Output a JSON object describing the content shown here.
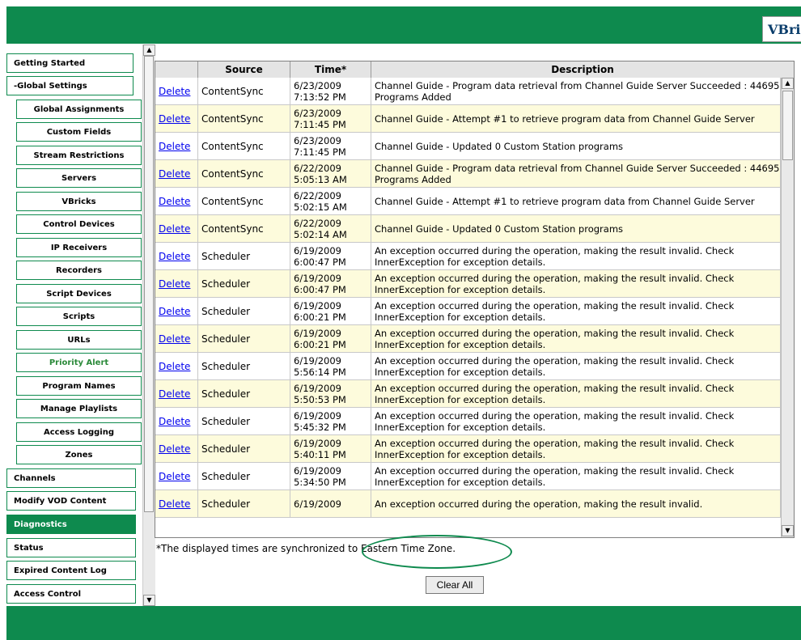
{
  "brand": {
    "logo_text": "VBrick"
  },
  "sidebar": {
    "items": [
      {
        "label": "Getting Started"
      },
      {
        "label": "-Global Settings"
      },
      {
        "label": "Global Assignments"
      },
      {
        "label": "Custom Fields"
      },
      {
        "label": "Stream Restrictions"
      },
      {
        "label": "Servers"
      },
      {
        "label": "VBricks"
      },
      {
        "label": "Control Devices"
      },
      {
        "label": "IP Receivers"
      },
      {
        "label": "Recorders"
      },
      {
        "label": "Script Devices"
      },
      {
        "label": "Scripts"
      },
      {
        "label": "URLs"
      },
      {
        "label": "Priority Alert"
      },
      {
        "label": "Program Names"
      },
      {
        "label": "Manage Playlists"
      },
      {
        "label": "Access Logging"
      },
      {
        "label": "Zones"
      },
      {
        "label": "Channels"
      },
      {
        "label": "Modify VOD Content"
      },
      {
        "label": "Diagnostics"
      },
      {
        "label": "Status"
      },
      {
        "label": "Expired Content Log"
      },
      {
        "label": "Access Control"
      }
    ]
  },
  "table": {
    "columns": [
      "",
      "Source",
      "Time*",
      "Description"
    ],
    "delete_label": "Delete",
    "rows": [
      {
        "source": "ContentSync",
        "date": "6/23/2009",
        "time": "7:13:52 PM",
        "description": "Channel Guide - Program data retrieval from Channel Guide Server Succeeded : 44695 Programs Added"
      },
      {
        "source": "ContentSync",
        "date": "6/23/2009",
        "time": "7:11:45 PM",
        "description": "Channel Guide - Attempt #1 to retrieve program data from Channel Guide Server"
      },
      {
        "source": "ContentSync",
        "date": "6/23/2009",
        "time": "7:11:45 PM",
        "description": "Channel Guide - Updated 0 Custom Station programs"
      },
      {
        "source": "ContentSync",
        "date": "6/22/2009",
        "time": "5:05:13 AM",
        "description": "Channel Guide - Program data retrieval from Channel Guide Server Succeeded : 44695 Programs Added"
      },
      {
        "source": "ContentSync",
        "date": "6/22/2009",
        "time": "5:02:15 AM",
        "description": "Channel Guide - Attempt #1 to retrieve program data from Channel Guide Server"
      },
      {
        "source": "ContentSync",
        "date": "6/22/2009",
        "time": "5:02:14 AM",
        "description": "Channel Guide - Updated 0 Custom Station programs"
      },
      {
        "source": "Scheduler",
        "date": "6/19/2009",
        "time": "6:00:47 PM",
        "description": "An exception occurred during the operation, making the result invalid. Check InnerException for exception details."
      },
      {
        "source": "Scheduler",
        "date": "6/19/2009",
        "time": "6:00:47 PM",
        "description": "An exception occurred during the operation, making the result invalid. Check InnerException for exception details."
      },
      {
        "source": "Scheduler",
        "date": "6/19/2009",
        "time": "6:00:21 PM",
        "description": "An exception occurred during the operation, making the result invalid. Check InnerException for exception details."
      },
      {
        "source": "Scheduler",
        "date": "6/19/2009",
        "time": "6:00:21 PM",
        "description": "An exception occurred during the operation, making the result invalid. Check InnerException for exception details."
      },
      {
        "source": "Scheduler",
        "date": "6/19/2009",
        "time": "5:56:14 PM",
        "description": "An exception occurred during the operation, making the result invalid. Check InnerException for exception details."
      },
      {
        "source": "Scheduler",
        "date": "6/19/2009",
        "time": "5:50:53 PM",
        "description": "An exception occurred during the operation, making the result invalid. Check InnerException for exception details."
      },
      {
        "source": "Scheduler",
        "date": "6/19/2009",
        "time": "5:45:32 PM",
        "description": "An exception occurred during the operation, making the result invalid. Check InnerException for exception details."
      },
      {
        "source": "Scheduler",
        "date": "6/19/2009",
        "time": "5:40:11 PM",
        "description": "An exception occurred during the operation, making the result invalid. Check InnerException for exception details."
      },
      {
        "source": "Scheduler",
        "date": "6/19/2009",
        "time": "5:34:50 PM",
        "description": "An exception occurred during the operation, making the result invalid. Check InnerException for exception details."
      },
      {
        "source": "Scheduler",
        "date": "6/19/2009",
        "time": "",
        "description": "An exception occurred during the operation, making the result invalid."
      }
    ]
  },
  "footer_note": "*The displayed times are synchronized to Eastern Time Zone.",
  "clear_all_label": "Clear All",
  "colors": {
    "accent": "#0e8a4e",
    "alt_row": "#fdfbdc",
    "link": "#0000ee"
  }
}
